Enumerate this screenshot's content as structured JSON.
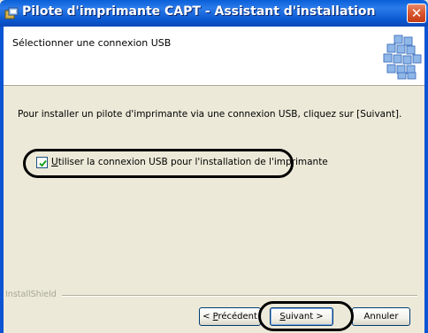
{
  "window": {
    "title": "Pilote d'imprimante CAPT - Assistant d'installation",
    "close_icon": "close-icon",
    "title_icon": "installer-icon"
  },
  "header": {
    "title": "Sélectionner une connexion USB",
    "graphic_icon": "printer-blocks-graphic"
  },
  "body": {
    "instruction": "Pour installer un pilote d'imprimante via une connexion USB, cliquez sur [Suivant].",
    "checkbox": {
      "mnemonic": "U",
      "label_rest": "tiliser la connexion USB pour l'installation de l'imprimante",
      "checked": true
    }
  },
  "footer": {
    "brand": "InstallShield",
    "buttons": {
      "prev_prefix": "< ",
      "prev_mnemonic": "P",
      "prev_rest": "récédent",
      "next_mnemonic": "S",
      "next_rest": "uivant >",
      "cancel": "Annuler"
    }
  }
}
